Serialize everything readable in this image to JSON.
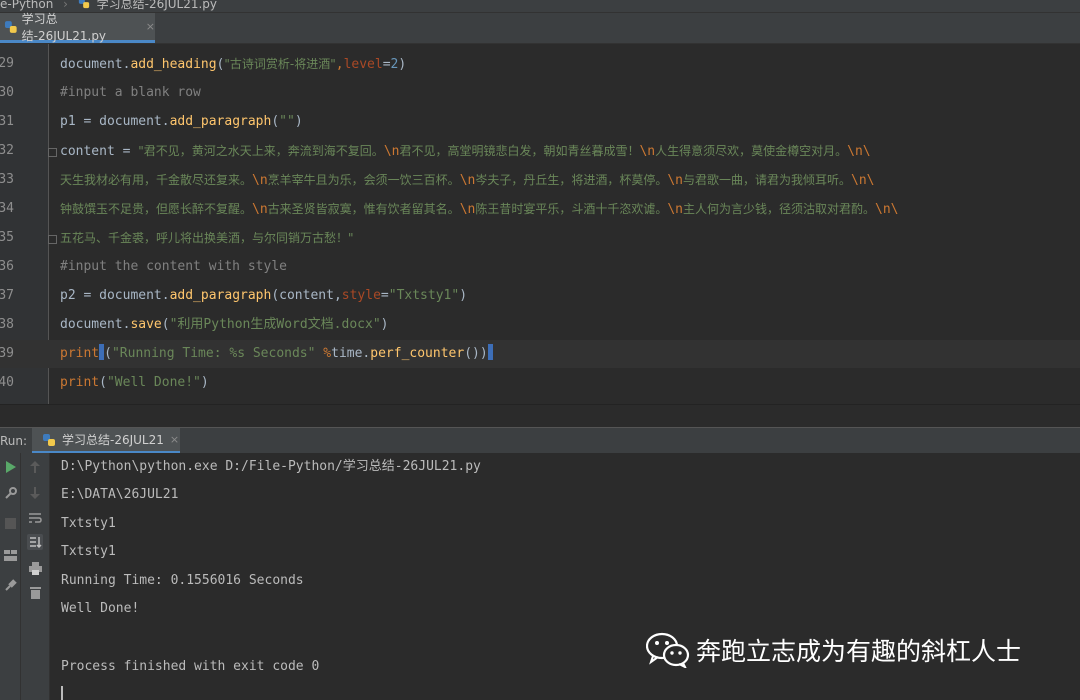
{
  "breadcrumb": {
    "project": "e-Python",
    "file": "学习总结-26JUL21.py"
  },
  "editor_tab": {
    "label": "学习总结-26JUL21.py",
    "close": "×"
  },
  "editor": {
    "lines": [
      {
        "num": "29"
      },
      {
        "num": "30"
      },
      {
        "num": "31"
      },
      {
        "num": "32"
      },
      {
        "num": "33"
      },
      {
        "num": "34"
      },
      {
        "num": "35"
      },
      {
        "num": "36"
      },
      {
        "num": "37"
      },
      {
        "num": "38"
      },
      {
        "num": "39"
      },
      {
        "num": "40"
      }
    ],
    "tokens": {
      "l29_obj": "document",
      "l29_dot": ".",
      "l29_fn": "add_heading",
      "l29_p1": "(",
      "l29_str": "\"古诗词赏析-将进酒\"",
      "l29_comma": ",",
      "l29_param": "level",
      "l29_eq": "=",
      "l29_num": "2",
      "l29_p2": ")",
      "l30_cmt": "#input a blank row",
      "l31_var": "p1 = document.",
      "l31_fn": "add_paragraph",
      "l31_p1": "(",
      "l31_str": "\"\"",
      "l31_p2": ")",
      "l32_var": "content = ",
      "l32_s1": "\"君不见，黄河之水天上来，奔流到海不复回。",
      "l32_e1": "\\n",
      "l32_s2": "君不见，高堂明镜悲白发，朝如青丝暮成雪！",
      "l32_e2": "\\n",
      "l32_s3": "人生得意须尽欢，莫使金樽空对月。",
      "l32_e3": "\\n\\",
      "l33_s1": "天生我材必有用，千金散尽还复来。",
      "l33_e1": "\\n",
      "l33_s2": "烹羊宰牛且为乐，会须一饮三百杯。",
      "l33_e2": "\\n",
      "l33_s3": "岑夫子，丹丘生，将进酒，杯莫停。",
      "l33_e3": "\\n",
      "l33_s4": "与君歌一曲，请君为我倾耳听。",
      "l33_e4": "\\n\\",
      "l34_s1": "钟鼓馔玉不足贵，但愿长醉不复醒。",
      "l34_e1": "\\n",
      "l34_s2": "古来圣贤皆寂寞，惟有饮者留其名。",
      "l34_e2": "\\n",
      "l34_s3": "陈王昔时宴平乐，斗酒十千恣欢谑。",
      "l34_e3": "\\n",
      "l34_s4": "主人何为言少钱，径须沽取对君酌。",
      "l34_e4": "\\n\\",
      "l35_s1": "五花马、千金裘，呼儿将出换美酒，与尔同销万古愁！\"",
      "l36_cmt": "#input the content with style",
      "l37_var": "p2 = document.",
      "l37_fn": "add_paragraph",
      "l37_p1": "(content,",
      "l37_param": "style",
      "l37_eq": "=",
      "l37_str": "\"Txtsty1\"",
      "l37_p2": ")",
      "l38_obj": "document.",
      "l38_fn": "save",
      "l38_p1": "(",
      "l38_str": "\"利用Python生成Word文档.docx\"",
      "l38_p2": ")",
      "l39_fn": "print",
      "l39_p1": "(",
      "l39_str": "\"Running Time: %s Seconds\"",
      "l39_op": " %",
      "l39_obj": "time.",
      "l39_fn2": "perf_counter",
      "l39_p2": "())",
      "l40_fn": "print",
      "l40_p1": "(",
      "l40_str": "\"Well Done!\"",
      "l40_p2": ")"
    }
  },
  "run_panel": {
    "label": "Run:",
    "tab": "学习总结-26JUL21",
    "close": "×",
    "output": [
      "D:\\Python\\python.exe D:/File-Python/学习总结-26JUL21.py",
      "E:\\DATA\\26JUL21",
      "Txtsty1",
      "Txtsty1",
      "Running Time: 0.1556016 Seconds",
      "Well Done!",
      "",
      "Process finished with exit code 0"
    ]
  },
  "icons": {
    "rerun": "rerun-icon",
    "stop": "stop-icon",
    "settings": "wrench-icon",
    "up": "arrow-up-icon",
    "down": "arrow-down-icon",
    "wrap": "soft-wrap-icon",
    "scroll": "scroll-to-end-icon",
    "print": "print-icon",
    "trash": "trash-icon",
    "layout": "layout-icon",
    "pin": "pin-icon"
  },
  "watermark": {
    "text": "奔跑立志成为有趣的斜杠人士"
  },
  "colors": {
    "accent": "#4a88c7",
    "keyword": "#cc7832",
    "function": "#ffc66d",
    "string": "#6a8759",
    "comment": "#808080",
    "number": "#6897bb"
  }
}
